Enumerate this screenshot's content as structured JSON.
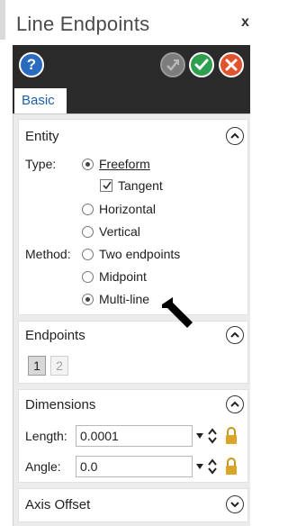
{
  "window": {
    "title": "Line Endpoints",
    "close_glyph": "x"
  },
  "toolbar": {
    "help_label": "?",
    "buttons": [
      "help-icon",
      "reapply-icon",
      "ok-icon",
      "cancel-icon"
    ],
    "colors": {
      "help": "#2a6bbf",
      "ok": "#2e9e4f",
      "cancel": "#e0532c",
      "disabled": "#7c7c7c"
    }
  },
  "tabs": [
    {
      "label": "Basic",
      "selected": true
    }
  ],
  "entity": {
    "header": "Entity",
    "type_label": "Type:",
    "type_options": [
      {
        "label": "Freeform",
        "underline": "F",
        "selected": true
      },
      {
        "label": "Horizontal",
        "underline": "H",
        "selected": false
      },
      {
        "label": "Vertical",
        "underline": "V",
        "selected": false
      }
    ],
    "tangent": {
      "label": "Tangent",
      "checked": true
    },
    "method_label": "Method:",
    "method_options": [
      {
        "label": "Two endpoints",
        "selected": false
      },
      {
        "label": "Midpoint",
        "selected": false
      },
      {
        "label": "Multi-line",
        "selected": true
      }
    ]
  },
  "endpoints": {
    "header": "Endpoints",
    "buttons": [
      {
        "label": "1",
        "active": true
      },
      {
        "label": "2",
        "active": false
      }
    ]
  },
  "dimensions": {
    "header": "Dimensions",
    "length": {
      "label": "Length:",
      "value": "0.0001"
    },
    "angle": {
      "label": "Angle:",
      "value": "0.0"
    }
  },
  "axis_offset": {
    "header": "Axis Offset",
    "expanded": false
  }
}
